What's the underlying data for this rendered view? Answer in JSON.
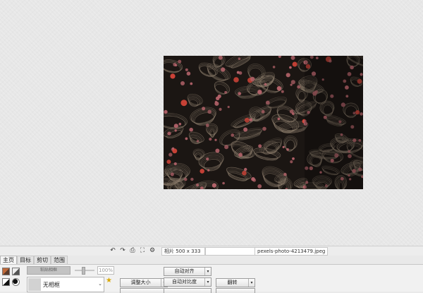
{
  "image": {
    "subject": "fishing nets with red floats",
    "colors": {
      "background": "#1b1613",
      "rope": "#8a7b6a",
      "float_red": "#d9463a",
      "float_pink": "#b4636a"
    }
  },
  "statusbar": {
    "icons": [
      "undo-icon",
      "redo-icon",
      "print-icon",
      "zoom-fit-icon",
      "actual-size-icon"
    ],
    "dimensions": "相片 500 x 333",
    "empty_field": "",
    "filename": "pexels-photo-4213479.jpeg"
  },
  "tabs": [
    {
      "label": "主页",
      "active": true
    },
    {
      "label": "目标",
      "active": false
    },
    {
      "label": "剪切",
      "active": false
    },
    {
      "label": "范围",
      "active": false
    }
  ],
  "panel": {
    "paste_frame_label": "粘贴相框",
    "opacity": "100%",
    "frame_select": {
      "value": "无相框"
    },
    "buttons": {
      "resize": "调整大小",
      "auto_align": "自动对齐",
      "auto_contrast": "自动对比度",
      "rotate": "翻转"
    }
  }
}
